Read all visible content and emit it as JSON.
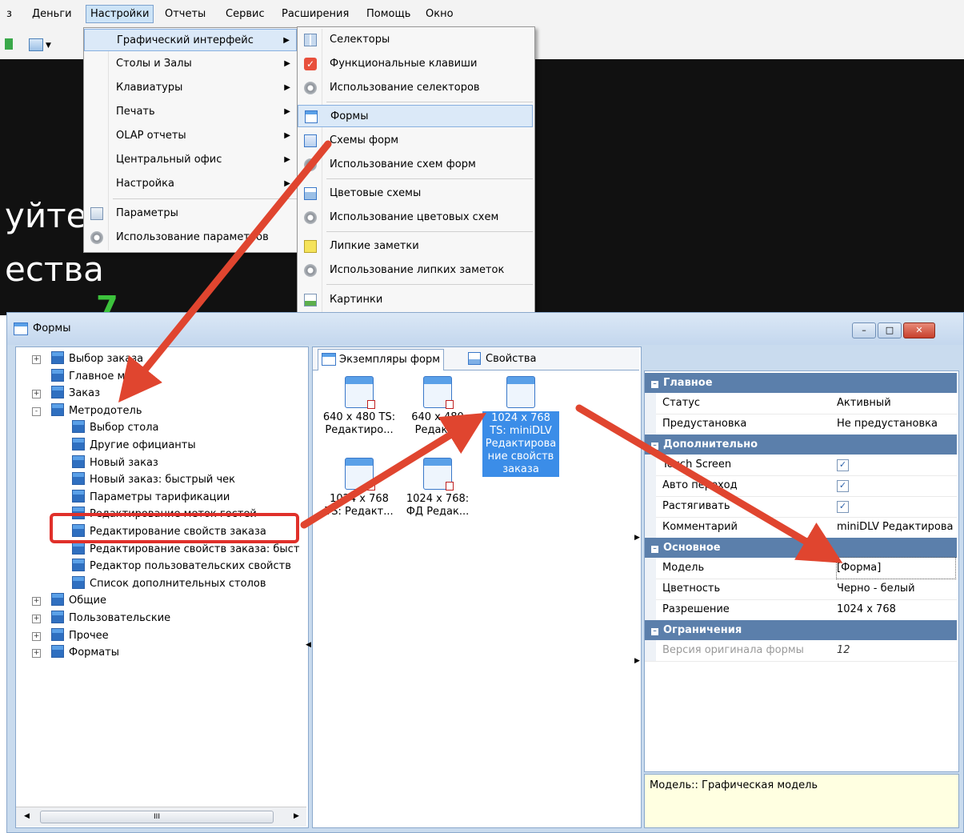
{
  "menubar": {
    "items": [
      "з",
      "Деньги",
      "Настройки",
      "Отчеты",
      "Сервис",
      "Расширения",
      "Помощь",
      "Окно"
    ]
  },
  "background": {
    "line1": "уйте",
    "line2": "ества",
    "green_glyph": "7"
  },
  "settings_menu": {
    "items": [
      {
        "label": "Графический интерфейс",
        "submenu": true
      },
      {
        "label": "Столы и Залы",
        "submenu": true
      },
      {
        "label": "Клавиатуры",
        "submenu": true
      },
      {
        "label": "Печать",
        "submenu": true
      },
      {
        "label": "OLAP отчеты",
        "submenu": true
      },
      {
        "label": "Центральный офис",
        "submenu": true
      },
      {
        "label": "Настройка",
        "submenu": true
      },
      {
        "label": "Параметры",
        "submenu": false
      },
      {
        "label": "Использование параметров",
        "submenu": false
      }
    ]
  },
  "gui_submenu": {
    "items": [
      {
        "label": "Селекторы",
        "icon": "selectors-icon"
      },
      {
        "label": "Функциональные клавиши",
        "icon": "function-keys-icon"
      },
      {
        "label": "Использование селекторов",
        "icon": "usage-icon"
      },
      {
        "label": "Формы",
        "icon": "forms-icon"
      },
      {
        "label": "Схемы форм",
        "icon": "form-schemes-icon"
      },
      {
        "label": "Использование схем форм",
        "icon": "usage-icon"
      },
      {
        "label": "Цветовые схемы",
        "icon": "color-schemes-icon"
      },
      {
        "label": "Использование цветовых схем",
        "icon": "usage-icon"
      },
      {
        "label": "Липкие заметки",
        "icon": "sticky-notes-icon"
      },
      {
        "label": "Использование липких заметок",
        "icon": "usage-icon"
      },
      {
        "label": "Картинки",
        "icon": "pictures-icon"
      }
    ]
  },
  "window": {
    "title": "Формы",
    "tree": [
      {
        "label": "Выбор заказа",
        "level": 0,
        "expander": "+"
      },
      {
        "label": "Главное ме",
        "level": 0,
        "expander": ""
      },
      {
        "label": "Заказ",
        "level": 0,
        "expander": "+"
      },
      {
        "label": "Метродотель",
        "level": 0,
        "expander": "-"
      },
      {
        "label": "Выбор стола",
        "level": 1,
        "expander": ""
      },
      {
        "label": "Другие официанты",
        "level": 1,
        "expander": ""
      },
      {
        "label": "Новый заказ",
        "level": 1,
        "expander": ""
      },
      {
        "label": "Новый заказ: быстрый чек",
        "level": 1,
        "expander": ""
      },
      {
        "label": "Параметры тарификации",
        "level": 1,
        "expander": ""
      },
      {
        "label": "Редактирование меток гостей",
        "level": 1,
        "expander": ""
      },
      {
        "label": "Редактирование свойств заказа",
        "level": 1,
        "expander": ""
      },
      {
        "label": "Редактирование свойств заказа: быст",
        "level": 1,
        "expander": ""
      },
      {
        "label": "Редактор пользовательских свойств",
        "level": 1,
        "expander": ""
      },
      {
        "label": "Список дополнительных столов",
        "level": 1,
        "expander": ""
      },
      {
        "label": "Общие",
        "level": 0,
        "expander": "+"
      },
      {
        "label": "Пользовательские",
        "level": 0,
        "expander": "+"
      },
      {
        "label": "Прочее",
        "level": 0,
        "expander": "+"
      },
      {
        "label": "Форматы",
        "level": 0,
        "expander": "+"
      }
    ],
    "scrollbar_thumb": "III",
    "tabs": [
      "Экземпляры форм",
      "Свойства"
    ],
    "forms": [
      {
        "line1": "640 x 480 TS:",
        "line2": "Редактиро..."
      },
      {
        "line1": "640 x 480",
        "line2": "Редакти"
      },
      {
        "line1": "1024 x 768",
        "line2": "TS: miniDLV",
        "line3": "Редактирова",
        "line4": "ние свойств",
        "line5": "заказа"
      },
      {
        "line1": "1024 x 768",
        "line2": "TS: Редакт..."
      },
      {
        "line1": "1024 x 768:",
        "line2": "ФД Редак..."
      }
    ],
    "properties": {
      "categories": [
        "Главное",
        "Дополнительно",
        "Основное",
        "Ограничения"
      ],
      "status_name": "Статус",
      "status_value": "Активный",
      "preset_name": "Предустановка",
      "preset_value": "Не предустановка",
      "touch_name": "Touch Screen",
      "auto_name": "Авто переход",
      "stretch_name": "Растягивать",
      "comment_name": "Комментарий",
      "comment_value": "miniDLV Редактирова",
      "model_name": "Модель",
      "model_value": "[Форма]",
      "color_name": "Цветность",
      "color_value": "Черно - белый",
      "res_name": "Разрешение",
      "res_value": "1024 x 768",
      "version_name": "Версия оригинала формы",
      "version_value": "12",
      "check_mark": "✓"
    },
    "description": "Модель:: Графическая модель"
  },
  "colors": {
    "arrow": "#e0452f",
    "highlight_box": "#e0302a",
    "selected": "#3b8de8",
    "category": "#5b7fab"
  }
}
